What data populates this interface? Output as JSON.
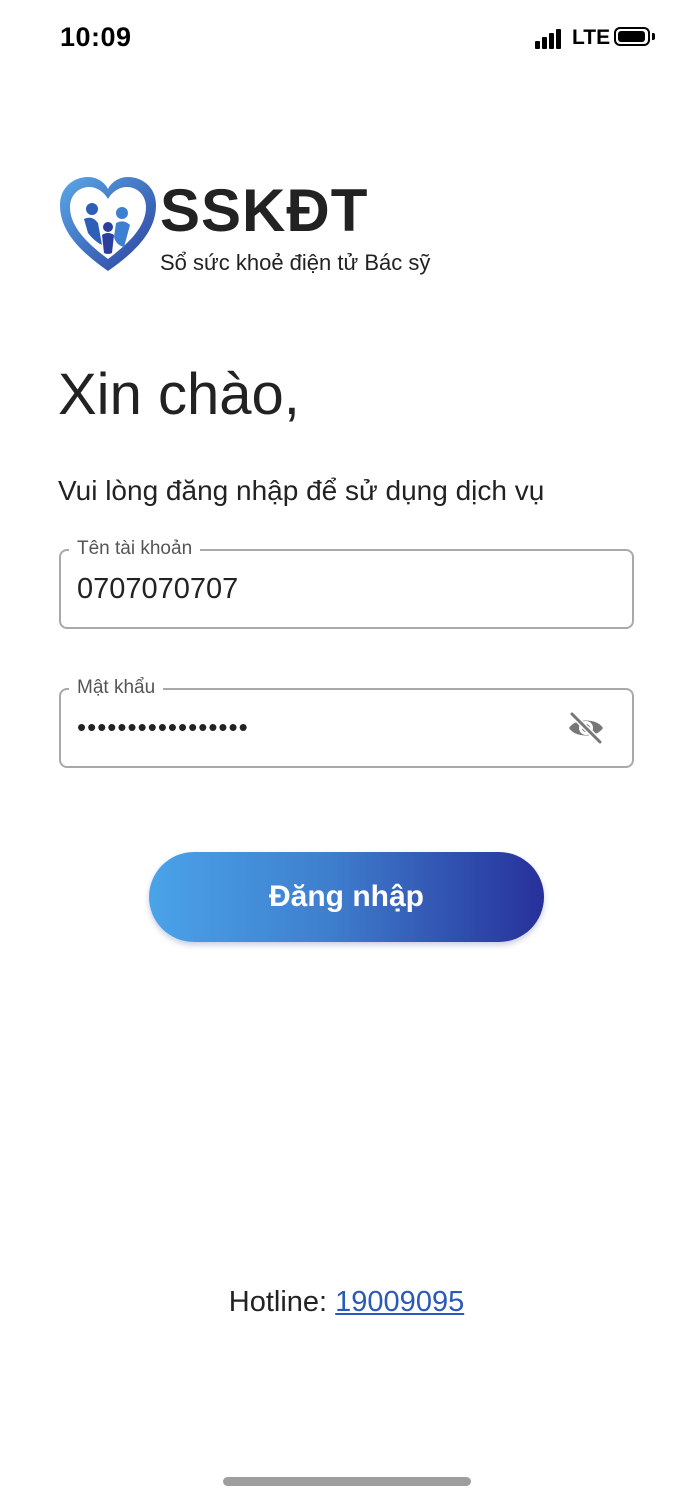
{
  "status_bar": {
    "time": "10:09",
    "network": "LTE",
    "signal_icon": "cellular-signal-icon",
    "battery_icon": "battery-icon",
    "battery_level": 0.95
  },
  "brand": {
    "logo_icon": "heart-family-logo-icon",
    "name": "SSKĐT",
    "tagline": "Sổ sức khoẻ điện tử Bác sỹ"
  },
  "greeting": {
    "title": "Xin chào,",
    "subtitle": "Vui lòng đăng nhập để sử dụng dịch vụ"
  },
  "form": {
    "username": {
      "label": "Tên tài khoản",
      "value": "0707070707"
    },
    "password": {
      "label": "Mật khẩu",
      "masked_value": "•••••••••••••••••",
      "toggle_icon": "eye-off-icon"
    },
    "submit_label": "Đăng nhập"
  },
  "hotline": {
    "label": "Hotline:",
    "number": "19009095"
  },
  "colors": {
    "accent_start": "#4aa3e8",
    "accent_end": "#27309a",
    "link": "#2a59b8",
    "text": "#222222",
    "field_border": "#a9a9a9"
  }
}
